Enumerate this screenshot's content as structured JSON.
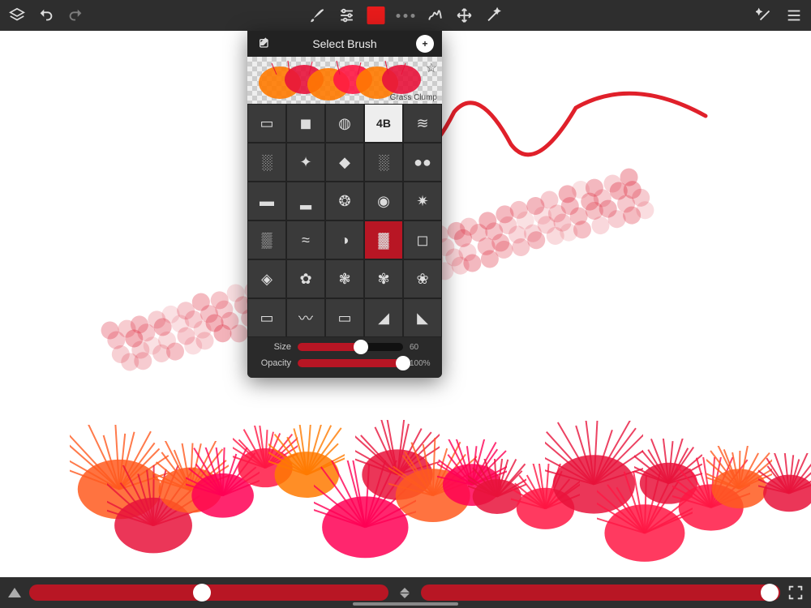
{
  "toolbar": {
    "color_swatch": "#e61b1b"
  },
  "popup": {
    "title": "Select Brush",
    "preview_brush_name": "Grass Clump",
    "size": {
      "label": "Size",
      "value": 60,
      "max": 100
    },
    "opacity": {
      "label": "Opacity",
      "value": 100,
      "display": "100%",
      "max": 100
    },
    "grid_label_4B": "4B",
    "selected_index": 18
  },
  "bottom": {
    "slider1_pos_pct": 48,
    "slider2_pos_pct": 97
  }
}
